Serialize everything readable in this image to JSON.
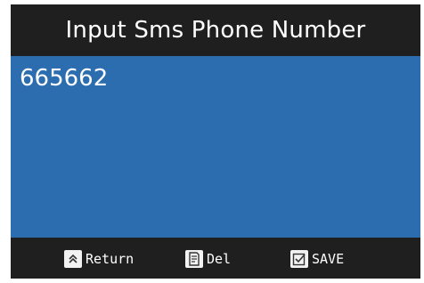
{
  "screen": {
    "title": "Input Sms Phone Number",
    "input_value": "665662"
  },
  "softkeys": [
    {
      "label": "Return",
      "icon": "double-chevron-up-icon"
    },
    {
      "label": "Del",
      "icon": "document-icon"
    },
    {
      "label": "SAVE",
      "icon": "checkbox-icon"
    }
  ],
  "colors": {
    "title_bar": "#1f1f1f",
    "content_bg": "#2c6db0",
    "footer_bg": "#1f1f1f",
    "text": "#ffffff",
    "icon_bg": "#f2f2f2"
  }
}
